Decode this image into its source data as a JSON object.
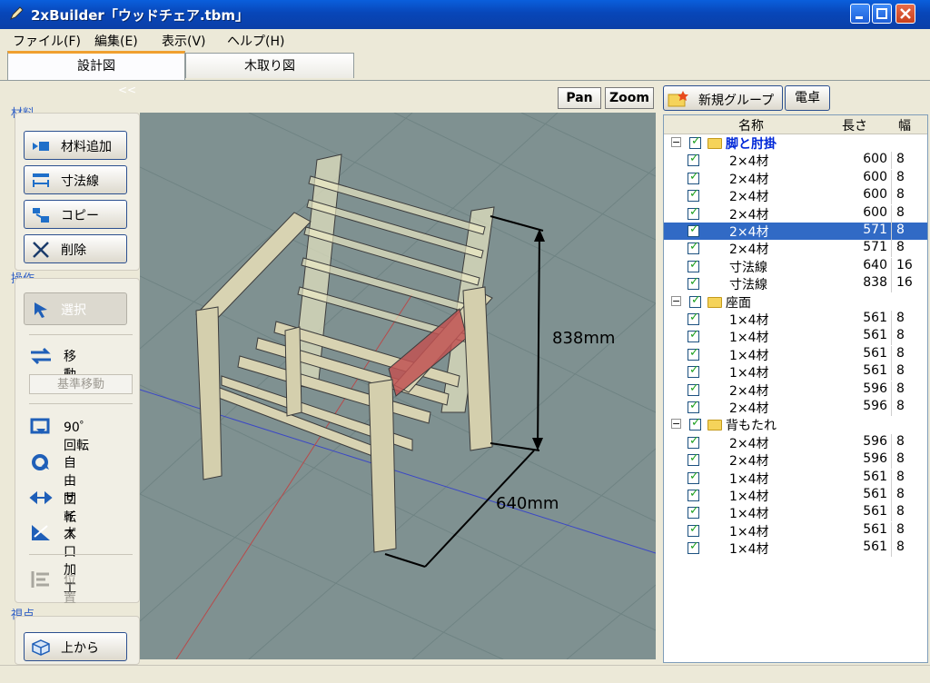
{
  "window": {
    "title": "2xBuilder「ウッドチェア.tbm」"
  },
  "menu": [
    "ファイル(F)",
    "編集(E)",
    "表示(V)",
    "ヘルプ(H)"
  ],
  "tabs": [
    {
      "label": "設計図"
    },
    {
      "label": "木取り図"
    }
  ],
  "left_panel": {
    "collapse": "<<",
    "material_group": "材料",
    "material_buttons": [
      "材料追加",
      "寸法線",
      "コピー",
      "削除"
    ],
    "operation_group": "操作",
    "select_label": "選択",
    "move_label": "移動",
    "base_move_label": "基準移動",
    "rotate90_label": "90゜回転",
    "free_rotate_label": "自由回転",
    "size_label": "サイズ",
    "end_process_label": "木口加工",
    "position_label": "位置",
    "view_group": "視点",
    "from_top_label": "上から"
  },
  "viewport": {
    "pan_label": "Pan",
    "zoom_label": "Zoom",
    "dim_height": "838mm",
    "dim_depth": "640mm"
  },
  "right_panel": {
    "new_group_label": "新規グループ",
    "calculator_label": "電卓",
    "headers": {
      "name": "名称",
      "length": "長さ",
      "width": "幅"
    },
    "groups": [
      {
        "name": "脚と肘掛",
        "bold": true,
        "items": [
          {
            "name": "2×4材",
            "length": "600",
            "width": "8"
          },
          {
            "name": "2×4材",
            "length": "600",
            "width": "8"
          },
          {
            "name": "2×4材",
            "length": "600",
            "width": "8"
          },
          {
            "name": "2×4材",
            "length": "600",
            "width": "8"
          },
          {
            "name": "2×4材",
            "length": "571",
            "width": "8",
            "selected": true
          },
          {
            "name": "2×4材",
            "length": "571",
            "width": "8"
          },
          {
            "name": "寸法線",
            "length": "640",
            "width": "16"
          },
          {
            "name": "寸法線",
            "length": "838",
            "width": "16"
          }
        ]
      },
      {
        "name": "座面",
        "bold": false,
        "items": [
          {
            "name": "1×4材",
            "length": "561",
            "width": "8"
          },
          {
            "name": "1×4材",
            "length": "561",
            "width": "8"
          },
          {
            "name": "1×4材",
            "length": "561",
            "width": "8"
          },
          {
            "name": "1×4材",
            "length": "561",
            "width": "8"
          },
          {
            "name": "2×4材",
            "length": "596",
            "width": "8"
          },
          {
            "name": "2×4材",
            "length": "596",
            "width": "8"
          }
        ]
      },
      {
        "name": "背もたれ",
        "bold": false,
        "items": [
          {
            "name": "2×4材",
            "length": "596",
            "width": "8"
          },
          {
            "name": "2×4材",
            "length": "596",
            "width": "8"
          },
          {
            "name": "1×4材",
            "length": "561",
            "width": "8"
          },
          {
            "name": "1×4材",
            "length": "561",
            "width": "8"
          },
          {
            "name": "1×4材",
            "length": "561",
            "width": "8"
          },
          {
            "name": "1×4材",
            "length": "561",
            "width": "8"
          },
          {
            "name": "1×4材",
            "length": "561",
            "width": "8"
          }
        ]
      }
    ]
  }
}
